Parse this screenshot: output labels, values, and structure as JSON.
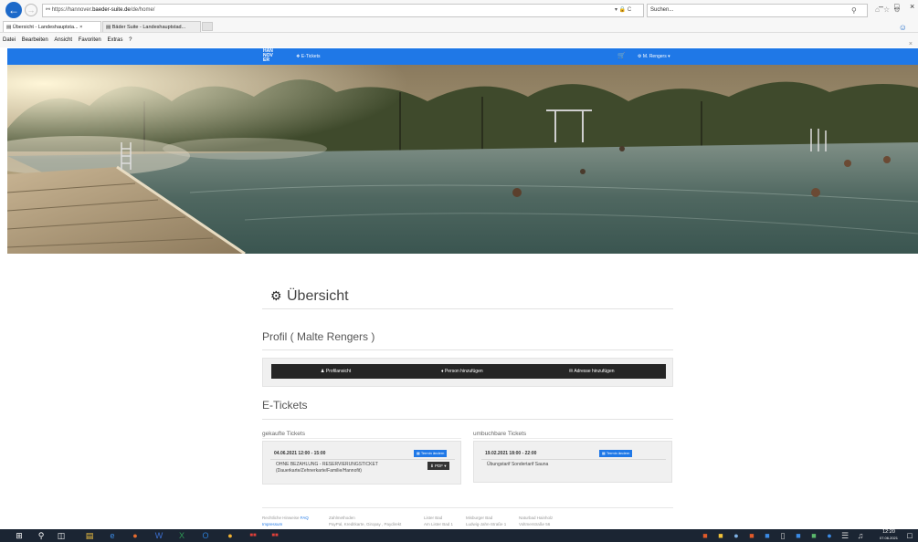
{
  "browser": {
    "url_prefix": "https://hannover.",
    "url_domain": "baeder-suite.de",
    "url_path": "/de/home/",
    "search_placeholder": "Suchen...",
    "tabs": [
      {
        "label": "Übersicht - Landeshauptsta..."
      },
      {
        "label": "Bäder Suite - Landeshauptstad..."
      }
    ],
    "menu": [
      "Datei",
      "Bearbeiten",
      "Ansicht",
      "Favoriten",
      "Extras",
      "?"
    ]
  },
  "topnav": {
    "logo_lines": [
      "HAN",
      "NOV",
      "ER"
    ],
    "etickets_label": "E-Tickets",
    "user_label": "M. Rengers ▾"
  },
  "page": {
    "title": "Übersicht",
    "profile_heading": "Profil ( Malte Rengers )",
    "profile_buttons": [
      "Profilansicht",
      "Person hinzufügen",
      "Adresse hinzufügen"
    ],
    "etickets_heading": "E-Tickets",
    "bought_title": "gekaufte Tickets",
    "rebookable_title": "umbuchbare Tickets",
    "bought_ticket": {
      "datetime": "04.06.2021 12:00 - 15:00",
      "change_label": "Termin ändern",
      "line1": "OHNE BEZAHLUNG - RESERVIERUNGSTICKET",
      "line2": "(Dauerkarte/Zehnerkarte/Familie/Hannofit)",
      "pdf_label": "PDF ▾"
    },
    "rebookable_ticket": {
      "datetime": "19.02.2021 18:00 - 22:00",
      "change_label": "Termin ändern",
      "line1": "Übungstarif Sondertarif Sauna"
    }
  },
  "footer": {
    "legal_label": "Rechtliche Hinweise",
    "faq_label": "FAQ",
    "impressum_label": "Impressum",
    "payment_title": "Zahlmethoden",
    "payment_methods": "PayPal, Kreditkarte, Giropay , Paydirekt",
    "bad1_title": "Lister Bad",
    "bad1_addr": "Am Lister Bad 1",
    "bad2_title": "Misburger Bad",
    "bad2_addr": "Ludwig-Jahn-Straße 1",
    "bad3_title": "Naturbad Hainholz",
    "bad3_addr": "Voltmerstraße 56"
  },
  "taskbar": {
    "time": "12:20",
    "date": "07.06.2021"
  },
  "colors": {
    "accent": "#1f78e7",
    "dark_bar": "#252525",
    "taskbar": "#1b2533"
  }
}
